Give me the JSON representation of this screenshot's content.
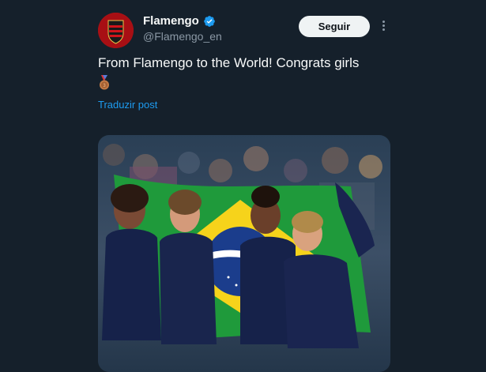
{
  "account": {
    "name": "Flamengo",
    "handle": "@Flamengo_en",
    "verified": true
  },
  "follow_label": "Seguir",
  "tweet": {
    "text": "From Flamengo to the World! Congrats girls",
    "emoji": "bronze-medal",
    "translate_label": "Traduzir post"
  },
  "colors": {
    "background": "#15202b",
    "link": "#1d9bf0",
    "verified": "#1d9bf0",
    "flamengo_red": "#c8102e"
  },
  "media": {
    "description_icon": "photo-gymnasts-brazil-flag"
  }
}
